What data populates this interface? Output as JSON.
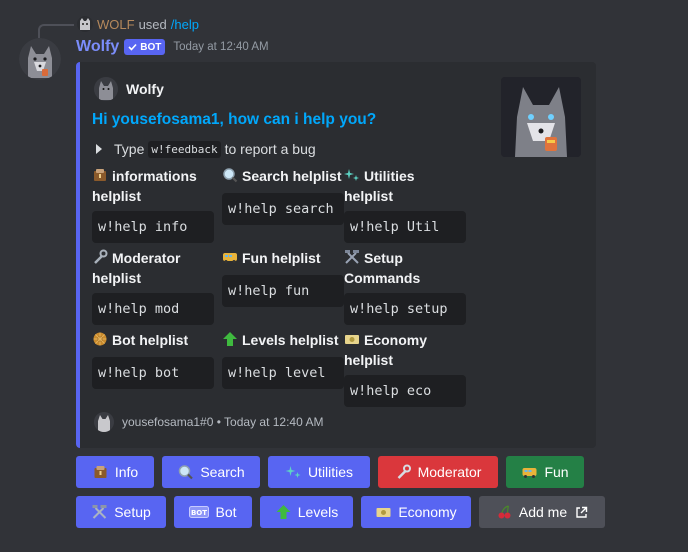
{
  "reply": {
    "user": "WOLF",
    "used": "used",
    "command": "/help"
  },
  "message": {
    "username": "Wolfy",
    "bot_tag": "BOT",
    "timestamp": "Today at 12:40 AM"
  },
  "embed": {
    "author": "Wolfy",
    "title": "Hi yousefosama1, how can i help you?",
    "desc_prefix": "Type",
    "desc_code": "w!feedback",
    "desc_suffix": "to report a bug",
    "fields": [
      {
        "name": "informations helplist",
        "value": "w!help info",
        "icon": "book-icon"
      },
      {
        "name": "Search helplist",
        "value": "w!help search",
        "icon": "magnifier-icon"
      },
      {
        "name": "Utilities helplist",
        "value": "w!help Util",
        "icon": "sparkles-icon"
      },
      {
        "name": "Moderator helplist",
        "value": "w!help mod",
        "icon": "wrench-icon"
      },
      {
        "name": "Fun helplist",
        "value": "w!help fun",
        "icon": "bus-icon"
      },
      {
        "name": "Setup Commands",
        "value": "w!help setup",
        "icon": "hammer-pick-icon"
      },
      {
        "name": "Bot helplist",
        "value": "w!help bot",
        "icon": "gear-wheel-icon"
      },
      {
        "name": "Levels helplist",
        "value": "w!help level",
        "icon": "up-arrow-icon"
      },
      {
        "name": "Economy helplist",
        "value": "w!help eco",
        "icon": "money-icon"
      }
    ],
    "footer": "yousefosama1#0 • Today at 12:40 AM"
  },
  "buttons_row1": [
    {
      "label": "Info",
      "icon": "book-icon",
      "color": "#5865f2"
    },
    {
      "label": "Search",
      "icon": "magnifier-icon",
      "color": "#5865f2"
    },
    {
      "label": "Utilities",
      "icon": "sparkles-icon",
      "color": "#5865f2"
    },
    {
      "label": "Moderator",
      "icon": "wrench-icon",
      "color": "#da373c"
    },
    {
      "label": "Fun",
      "icon": "bus-icon",
      "color": "#248046"
    }
  ],
  "buttons_row2": [
    {
      "label": "Setup",
      "icon": "hammer-pick-icon",
      "color": "#5865f2"
    },
    {
      "label": "Bot",
      "icon": "bot-icon",
      "color": "#5865f2"
    },
    {
      "label": "Levels",
      "icon": "up-arrow-icon",
      "color": "#5865f2"
    },
    {
      "label": "Economy",
      "icon": "money-icon",
      "color": "#5865f2"
    },
    {
      "label": "Add me",
      "icon": "cherries-icon",
      "color": "#4e5058"
    }
  ]
}
